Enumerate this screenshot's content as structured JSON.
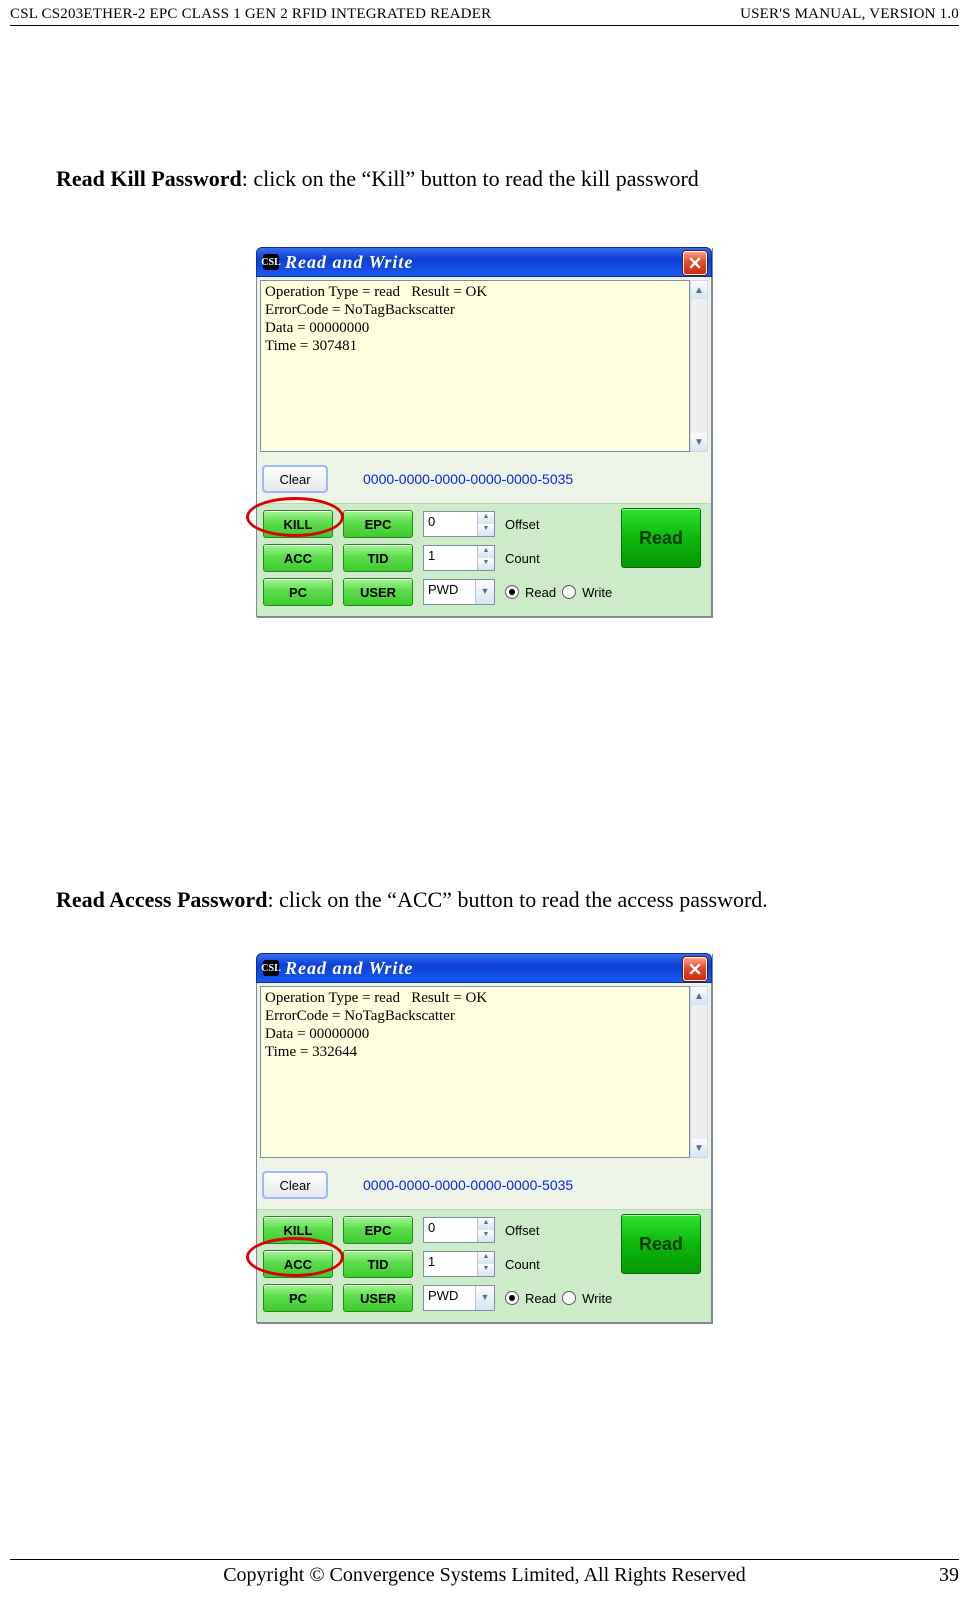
{
  "header": {
    "left": "CSL CS203ETHER-2 EPC CLASS 1 GEN 2 RFID INTEGRATED READER",
    "right": "USER'S  MANUAL,  VERSION  1.0"
  },
  "section1": {
    "caption_bold": "Read Kill Password",
    "caption_rest": ": click on the “Kill” button to read the kill password"
  },
  "section2": {
    "caption_bold": "Read Access Password",
    "caption_rest": ": click on the “ACC” button to read the access password."
  },
  "win_common": {
    "title": "Read and Write",
    "close_tooltip": "Close",
    "clear": "Clear",
    "tag_id": "0000-0000-0000-0000-0000-5035",
    "btns": {
      "kill": "KILL",
      "epc": "EPC",
      "acc": "ACC",
      "tid": "TID",
      "pc": "PC",
      "user": "USER"
    },
    "offset_label": "Offset",
    "count_label": "Count",
    "offset_value": "0",
    "count_value": "1",
    "select_value": "PWD",
    "read_btn": "Read",
    "radio_read": "Read",
    "radio_write": "Write"
  },
  "win1": {
    "log_line1": "Operation Type = read   Result = OK",
    "log_line2": "ErrorCode = NoTagBackscatter",
    "log_line3": "Data = 00000000",
    "log_line4": "Time = 307481"
  },
  "win2": {
    "log_line1": "Operation Type = read   Result = OK",
    "log_line2": "ErrorCode = NoTagBackscatter",
    "log_line3": "Data = 00000000",
    "log_line4": "Time = 332644"
  },
  "footer": {
    "center": "Copyright © Convergence Systems Limited, All Rights Reserved",
    "page": "39"
  }
}
